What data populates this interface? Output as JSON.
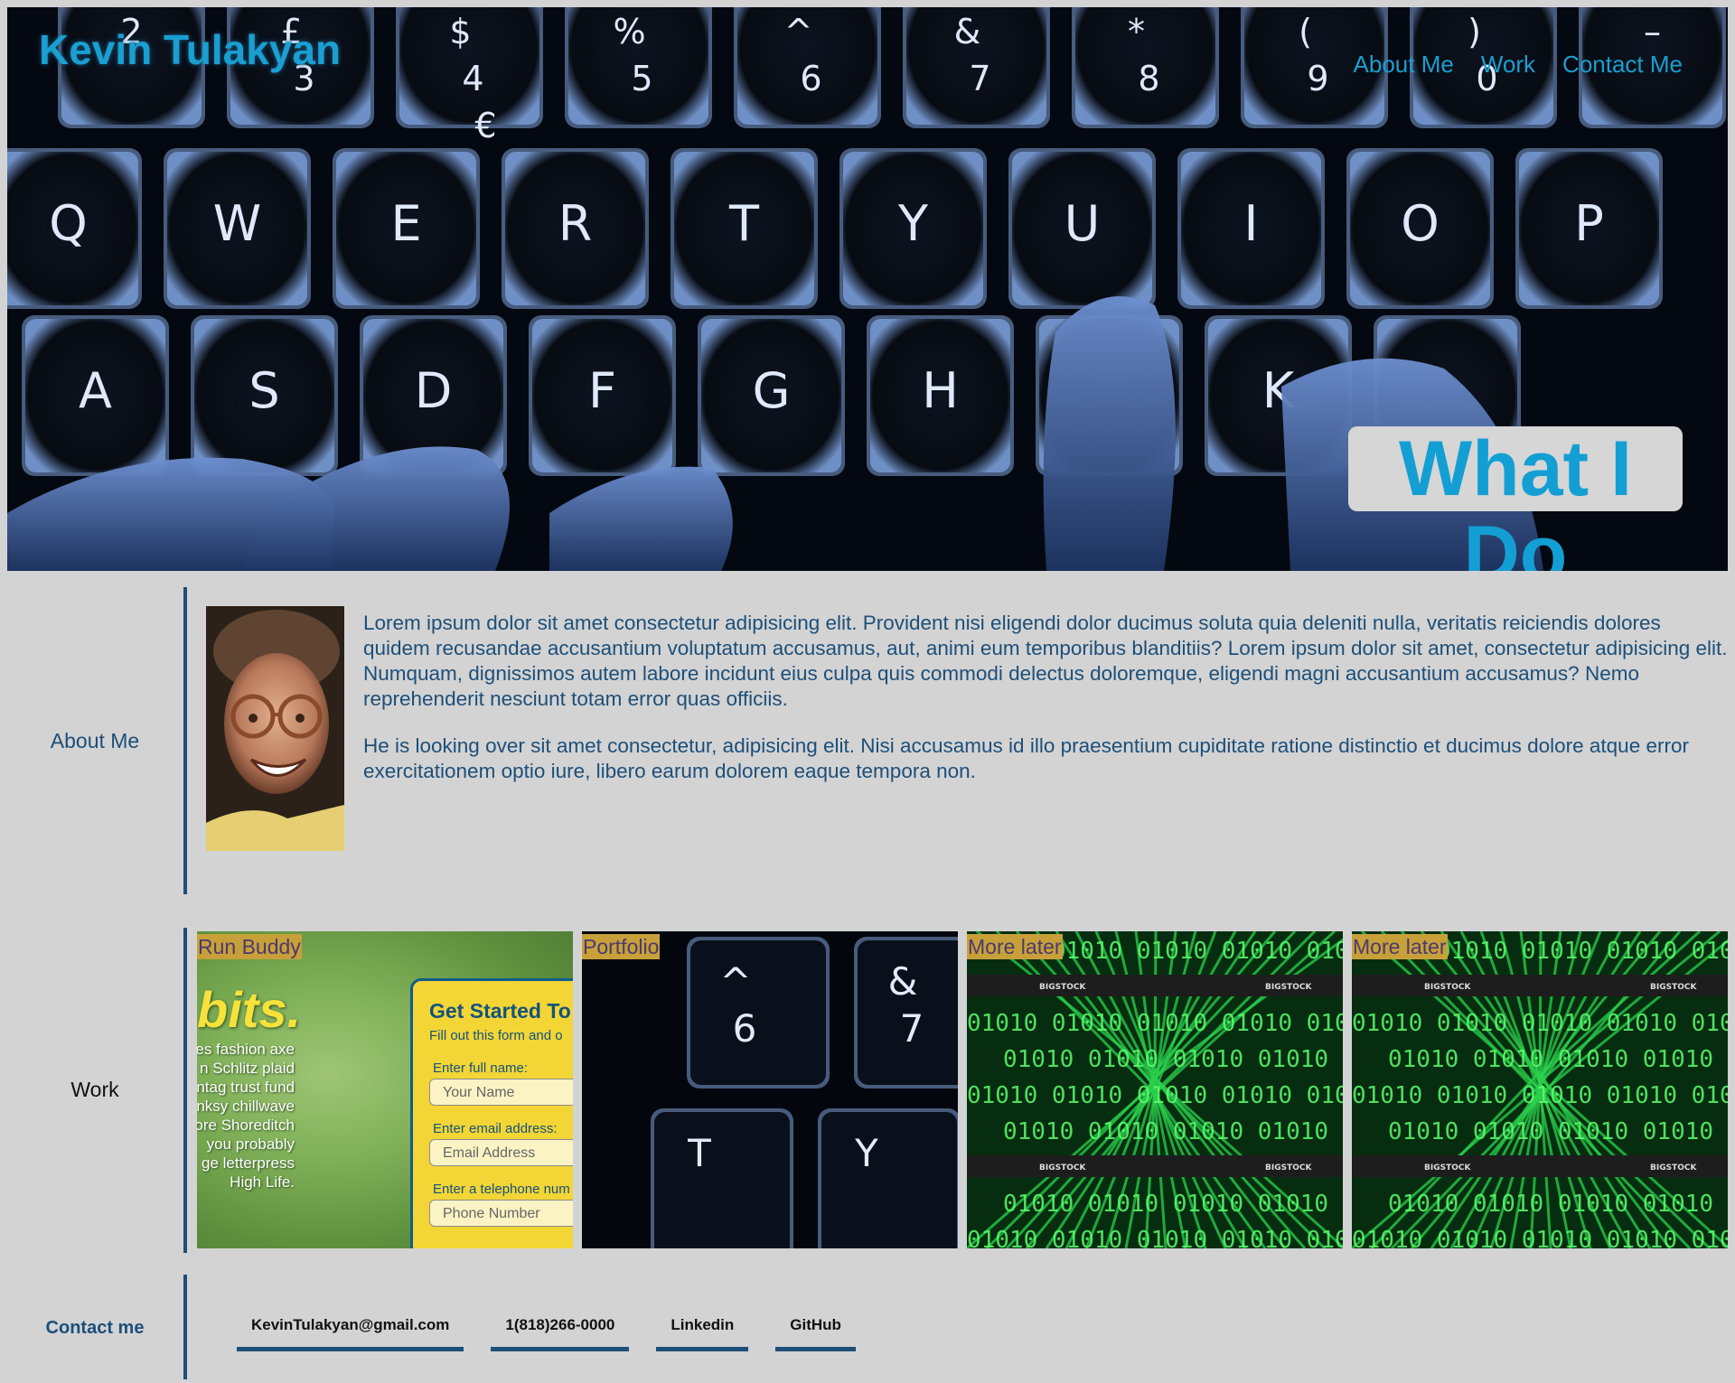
{
  "header": {
    "brand": "Kevin Tulakyan",
    "nav": [
      "About Me",
      "Work",
      "Contact Me"
    ],
    "hero_badge": "What I Do",
    "hero_keys": [
      [
        "2",
        "£ 3",
        "$ 4 €",
        "% 5",
        "^ 6",
        "& 7",
        "* 8",
        "( 9",
        ") 0",
        "–"
      ],
      [
        "Q",
        "W",
        "E",
        "R",
        "T",
        "Y",
        "U",
        "I",
        "O",
        "P"
      ],
      [
        "A",
        "S",
        "D",
        "F",
        "G",
        "H",
        "",
        "K",
        ""
      ]
    ]
  },
  "about": {
    "label": "About Me",
    "paragraphs": [
      "Lorem ipsum dolor sit amet consectetur adipisicing elit. Provident nisi eligendi dolor ducimus soluta quia deleniti nulla, veritatis reiciendis dolores quidem recusandae accusantium voluptatum accusamus, aut, animi eum temporibus blanditiis? Lorem ipsum dolor sit amet, consectetur adipisicing elit. Numquam, dignissimos autem labore incidunt eius culpa quis commodi delectus doloremque, eligendi magni accusantium accusamus? Nemo reprehenderit nesciunt totam error quas officiis.",
      "He is looking over sit amet consectetur, adipisicing elit. Nisi accusamus id illo praesentium cupiditate ratione distinctio et ducimus dolore atque error exercitationem optio iure, libero earum dolorem eaque tempora non."
    ]
  },
  "work": {
    "label": "Work",
    "cards": [
      {
        "title": "Run Buddy",
        "preview": {
          "headline": "bits.",
          "copy_lines": [
            "es fashion axe",
            "n Schlitz plaid",
            "ntag trust fund",
            "nksy chillwave",
            "ore Shoreditch",
            "you probably",
            "ge letterpress",
            "High Life."
          ],
          "form_title": "Get Started To",
          "form_subtitle": "Fill out this form and o",
          "fields": [
            {
              "label": "Enter full name:",
              "placeholder": "Your Name"
            },
            {
              "label": "Enter email address:",
              "placeholder": "Email Address"
            },
            {
              "label": "Enter a telephone num",
              "placeholder": "Phone Number"
            }
          ]
        }
      },
      {
        "title": "Portfolio",
        "preview_keys": [
          "^ 6",
          "& 7",
          "T",
          "Y"
        ]
      },
      {
        "title": "More later",
        "preview_text": [
          "BIGSTOCK",
          "01010"
        ]
      },
      {
        "title": "More later",
        "preview_text": [
          "BIGSTOCK",
          "01010"
        ]
      }
    ]
  },
  "contact": {
    "label": "Contact me",
    "links": [
      "KevinTulakyan@gmail.com",
      "1(818)266-0000",
      "Linkedin",
      "GitHub"
    ]
  },
  "colors": {
    "page_bg": "#d3d3d3",
    "accent_blue": "#1a9fd0",
    "navy": "#1c4f79",
    "card_label_bg": "#c8a03a"
  }
}
